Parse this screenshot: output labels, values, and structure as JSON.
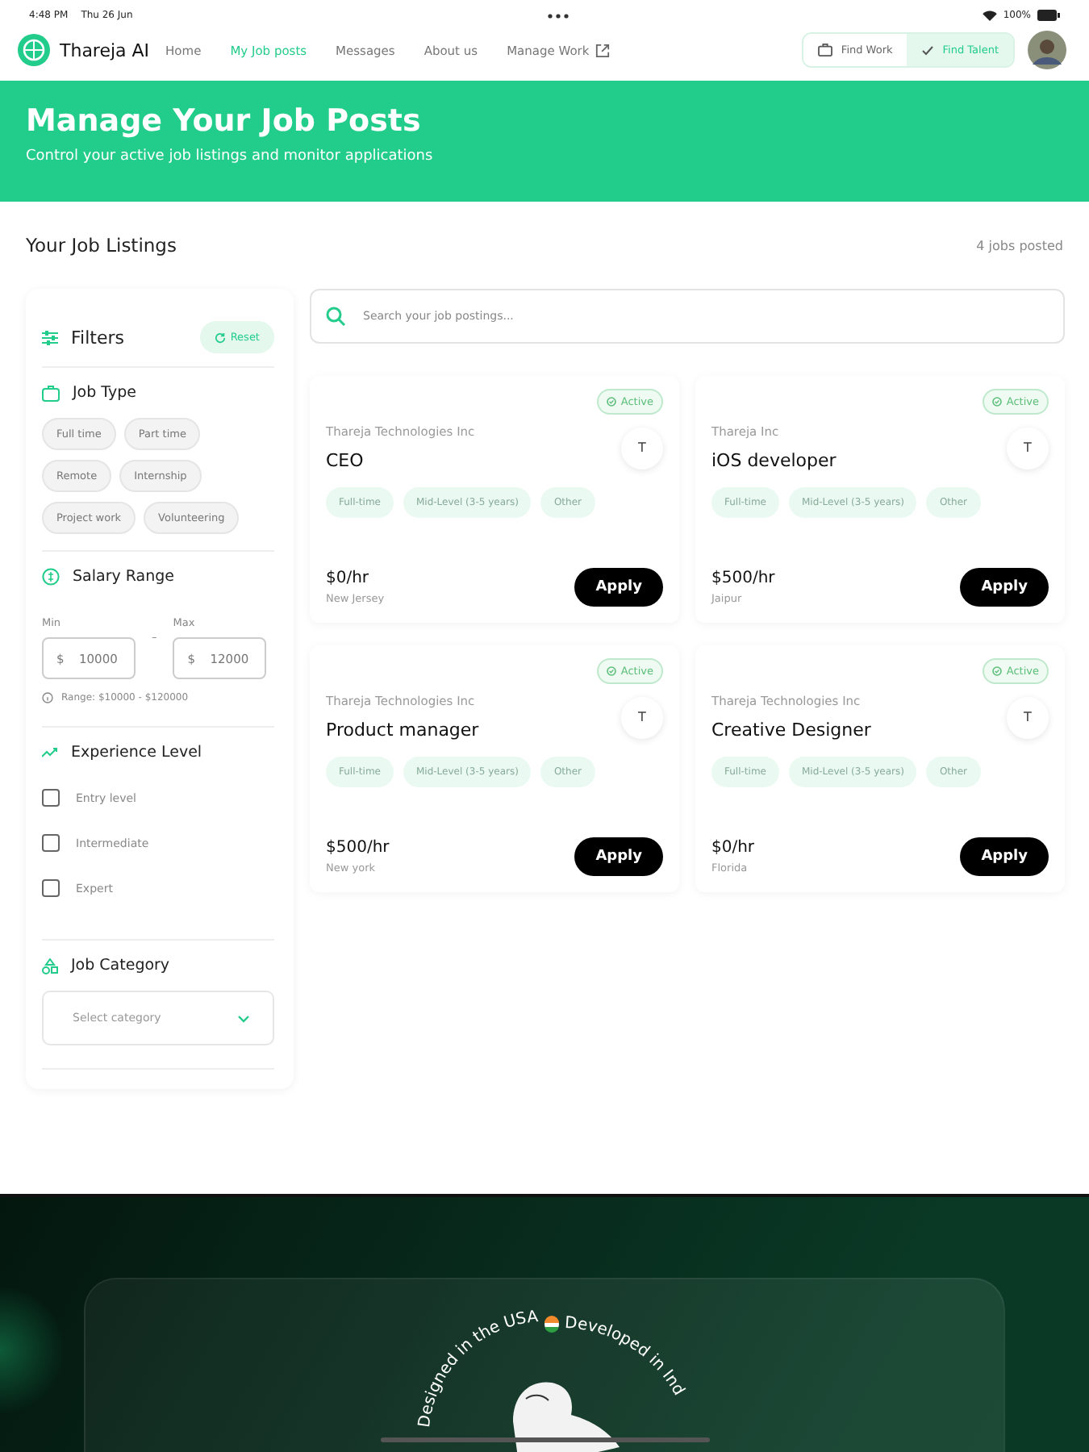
{
  "status_bar": {
    "time": "4:48 PM",
    "date": "Thu 26 Jun",
    "battery": "100%"
  },
  "nav": {
    "brand": "Thareja AI",
    "links": [
      {
        "label": "Home",
        "selected": false,
        "external": false
      },
      {
        "label": "My Job posts",
        "selected": true,
        "external": false
      },
      {
        "label": "Messages",
        "selected": false,
        "external": false
      },
      {
        "label": "About us",
        "selected": false,
        "external": false
      },
      {
        "label": "Manage Work",
        "selected": false,
        "external": true
      }
    ],
    "modes": [
      {
        "label": "Find Work",
        "selected": false
      },
      {
        "label": "Find Talent",
        "selected": true
      }
    ]
  },
  "banner": {
    "title": "Manage Your Job Posts",
    "subtitle": "Control your active job listings and monitor applications"
  },
  "listings": {
    "title": "Your Job Listings",
    "count": "4 jobs posted"
  },
  "filters": {
    "title": "Filters",
    "reset": "Reset",
    "job_type": {
      "title": "Job Type",
      "options": [
        {
          "label": "Full time",
          "selected": false
        },
        {
          "label": "Part time",
          "selected": false
        },
        {
          "label": "Remote",
          "selected": false
        },
        {
          "label": "Internship",
          "selected": false
        },
        {
          "label": "Project work",
          "selected": false
        },
        {
          "label": "Volunteering",
          "selected": false
        }
      ]
    },
    "salary": {
      "title": "Salary Range",
      "min_label": "Min",
      "max_label": "Max",
      "currency": "$",
      "min": "10000",
      "max": "12000",
      "separator": "–",
      "hint": "Range: $10000 - $120000"
    },
    "experience": {
      "title": "Experience Level",
      "options": [
        {
          "label": "Entry level",
          "checked": false
        },
        {
          "label": "Intermediate",
          "checked": false
        },
        {
          "label": "Expert",
          "checked": false
        }
      ]
    },
    "category": {
      "title": "Job Category",
      "placeholder": "Select category"
    }
  },
  "search": {
    "placeholder": "Search your job postings..."
  },
  "jobs": [
    {
      "status": "Active",
      "company": "Thareja Technologies Inc",
      "initial": "T",
      "title": "CEO",
      "tags": [
        "Full-time",
        "Mid-Level (3-5 years)",
        "Other"
      ],
      "rate": "$0/hr",
      "location": "New Jersey",
      "action": "Apply"
    },
    {
      "status": "Active",
      "company": "Thareja Inc",
      "initial": "T",
      "title": "iOS developer",
      "tags": [
        "Full-time",
        "Mid-Level (3-5 years)",
        "Other"
      ],
      "rate": "$500/hr",
      "location": "Jaipur",
      "action": "Apply"
    },
    {
      "status": "Active",
      "company": "Thareja Technologies Inc",
      "initial": "T",
      "title": "Product manager",
      "tags": [
        "Full-time",
        "Mid-Level (3-5 years)",
        "Other"
      ],
      "rate": "$500/hr",
      "location": "New york",
      "action": "Apply"
    },
    {
      "status": "Active",
      "company": "Thareja Technologies Inc",
      "initial": "T",
      "title": "Creative Designer",
      "tags": [
        "Full-time",
        "Mid-Level (3-5 years)",
        "Other"
      ],
      "rate": "$0/hr",
      "location": "Florida",
      "action": "Apply"
    }
  ],
  "footer": {
    "badge_left": "Designed in the USA",
    "badge_right": "Developed in Ind"
  }
}
